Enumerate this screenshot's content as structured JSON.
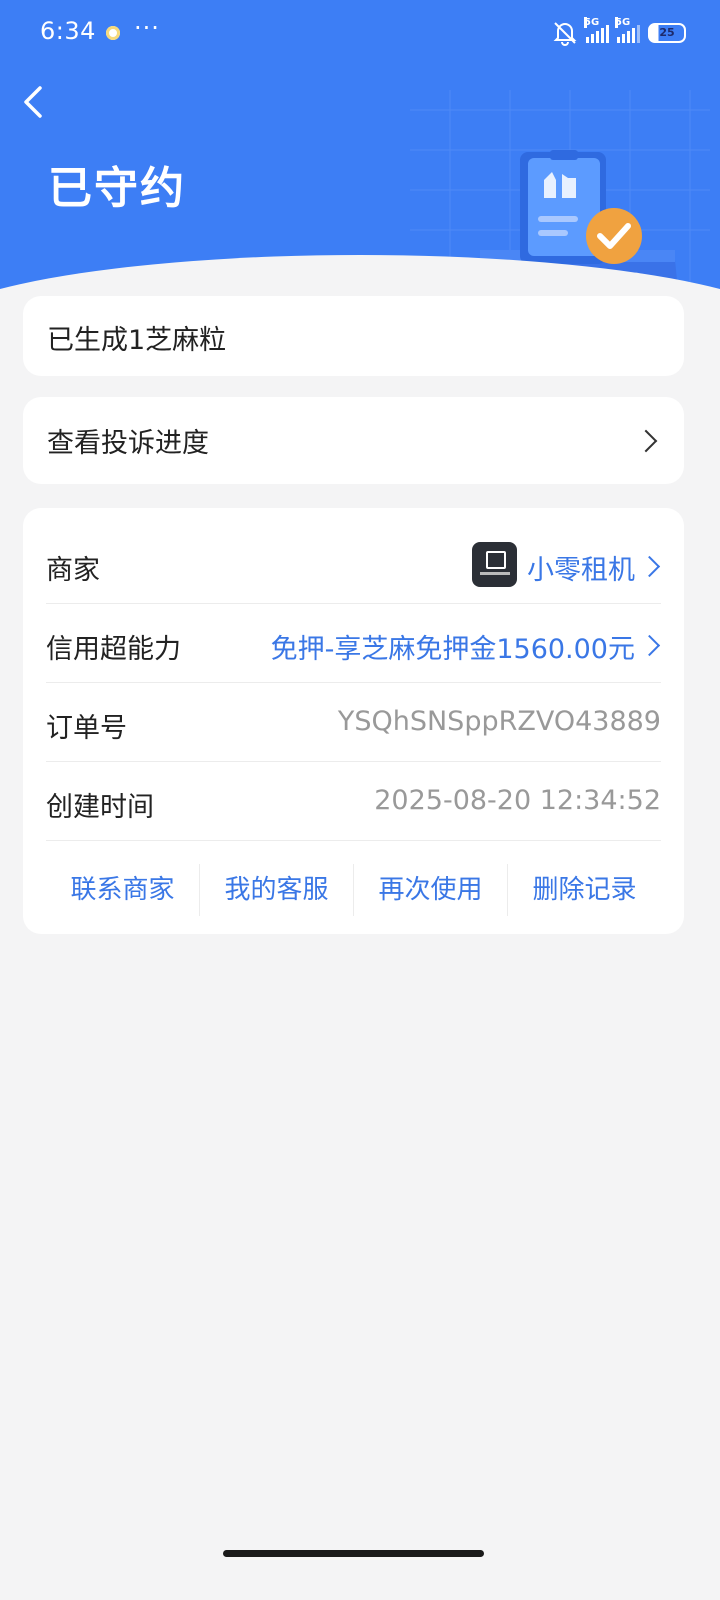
{
  "status_bar": {
    "time": "6:34",
    "more": "···",
    "network_1": "5G",
    "network_2": "5G",
    "battery": "25"
  },
  "header": {
    "title": "已守约"
  },
  "points_card": {
    "text": "已生成1芝麻粒"
  },
  "complaint_card": {
    "text": "查看投诉进度"
  },
  "details": {
    "merchant_label": "商家",
    "merchant_name": "小零租机",
    "credit_label": "信用超能力",
    "credit_value": "免押-享芝麻免押金1560.00元",
    "order_label": "订单号",
    "order_value": "YSQhSNSppRZVO43889",
    "created_label": "创建时间",
    "created_value": "2025-08-20 12:34:52"
  },
  "actions": [
    "联系商家",
    "我的客服",
    "再次使用",
    "删除记录"
  ],
  "colors": {
    "header_blue": "#3d7ef5",
    "link_blue": "#3a77e6",
    "check_orange": "#f0a240"
  }
}
